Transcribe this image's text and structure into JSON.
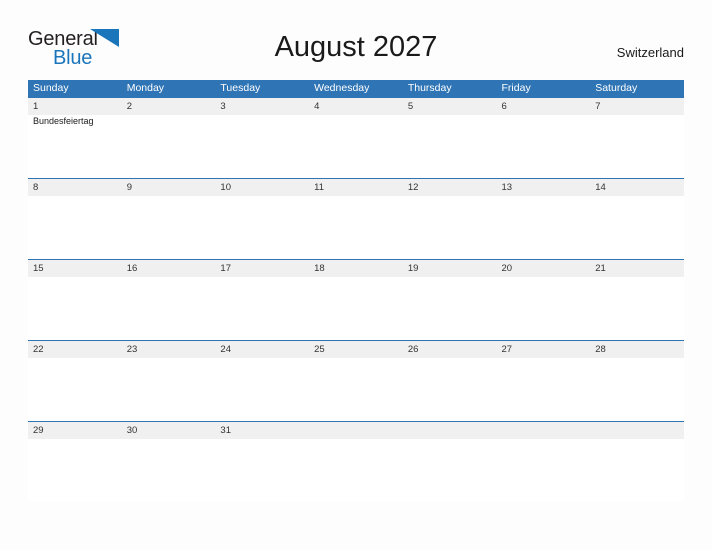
{
  "brand": {
    "name_part1": "General",
    "name_part2": "Blue",
    "flag_icon": "blue-triangle-flag-icon",
    "color_dark": "#231f20",
    "color_blue": "#1b75bb"
  },
  "header": {
    "title": "August 2027",
    "region": "Switzerland"
  },
  "theme": {
    "header_bar_color": "#2f74b5",
    "date_band_color": "#f0f0f0",
    "row_border_color": "#2f74b5",
    "page_background": "#fdfdfd",
    "text_color": "#1a1a1a"
  },
  "calendar": {
    "month": "August",
    "year": "2027",
    "weekdays": [
      "Sunday",
      "Monday",
      "Tuesday",
      "Wednesday",
      "Thursday",
      "Friday",
      "Saturday"
    ],
    "weeks": [
      {
        "days": [
          {
            "date": "1",
            "event": "Bundesfeiertag"
          },
          {
            "date": "2",
            "event": ""
          },
          {
            "date": "3",
            "event": ""
          },
          {
            "date": "4",
            "event": ""
          },
          {
            "date": "5",
            "event": ""
          },
          {
            "date": "6",
            "event": ""
          },
          {
            "date": "7",
            "event": ""
          }
        ]
      },
      {
        "days": [
          {
            "date": "8",
            "event": ""
          },
          {
            "date": "9",
            "event": ""
          },
          {
            "date": "10",
            "event": ""
          },
          {
            "date": "11",
            "event": ""
          },
          {
            "date": "12",
            "event": ""
          },
          {
            "date": "13",
            "event": ""
          },
          {
            "date": "14",
            "event": ""
          }
        ]
      },
      {
        "days": [
          {
            "date": "15",
            "event": ""
          },
          {
            "date": "16",
            "event": ""
          },
          {
            "date": "17",
            "event": ""
          },
          {
            "date": "18",
            "event": ""
          },
          {
            "date": "19",
            "event": ""
          },
          {
            "date": "20",
            "event": ""
          },
          {
            "date": "21",
            "event": ""
          }
        ]
      },
      {
        "days": [
          {
            "date": "22",
            "event": ""
          },
          {
            "date": "23",
            "event": ""
          },
          {
            "date": "24",
            "event": ""
          },
          {
            "date": "25",
            "event": ""
          },
          {
            "date": "26",
            "event": ""
          },
          {
            "date": "27",
            "event": ""
          },
          {
            "date": "28",
            "event": ""
          }
        ]
      },
      {
        "days": [
          {
            "date": "29",
            "event": ""
          },
          {
            "date": "30",
            "event": ""
          },
          {
            "date": "31",
            "event": ""
          },
          {
            "date": "",
            "event": ""
          },
          {
            "date": "",
            "event": ""
          },
          {
            "date": "",
            "event": ""
          },
          {
            "date": "",
            "event": ""
          }
        ]
      }
    ]
  }
}
